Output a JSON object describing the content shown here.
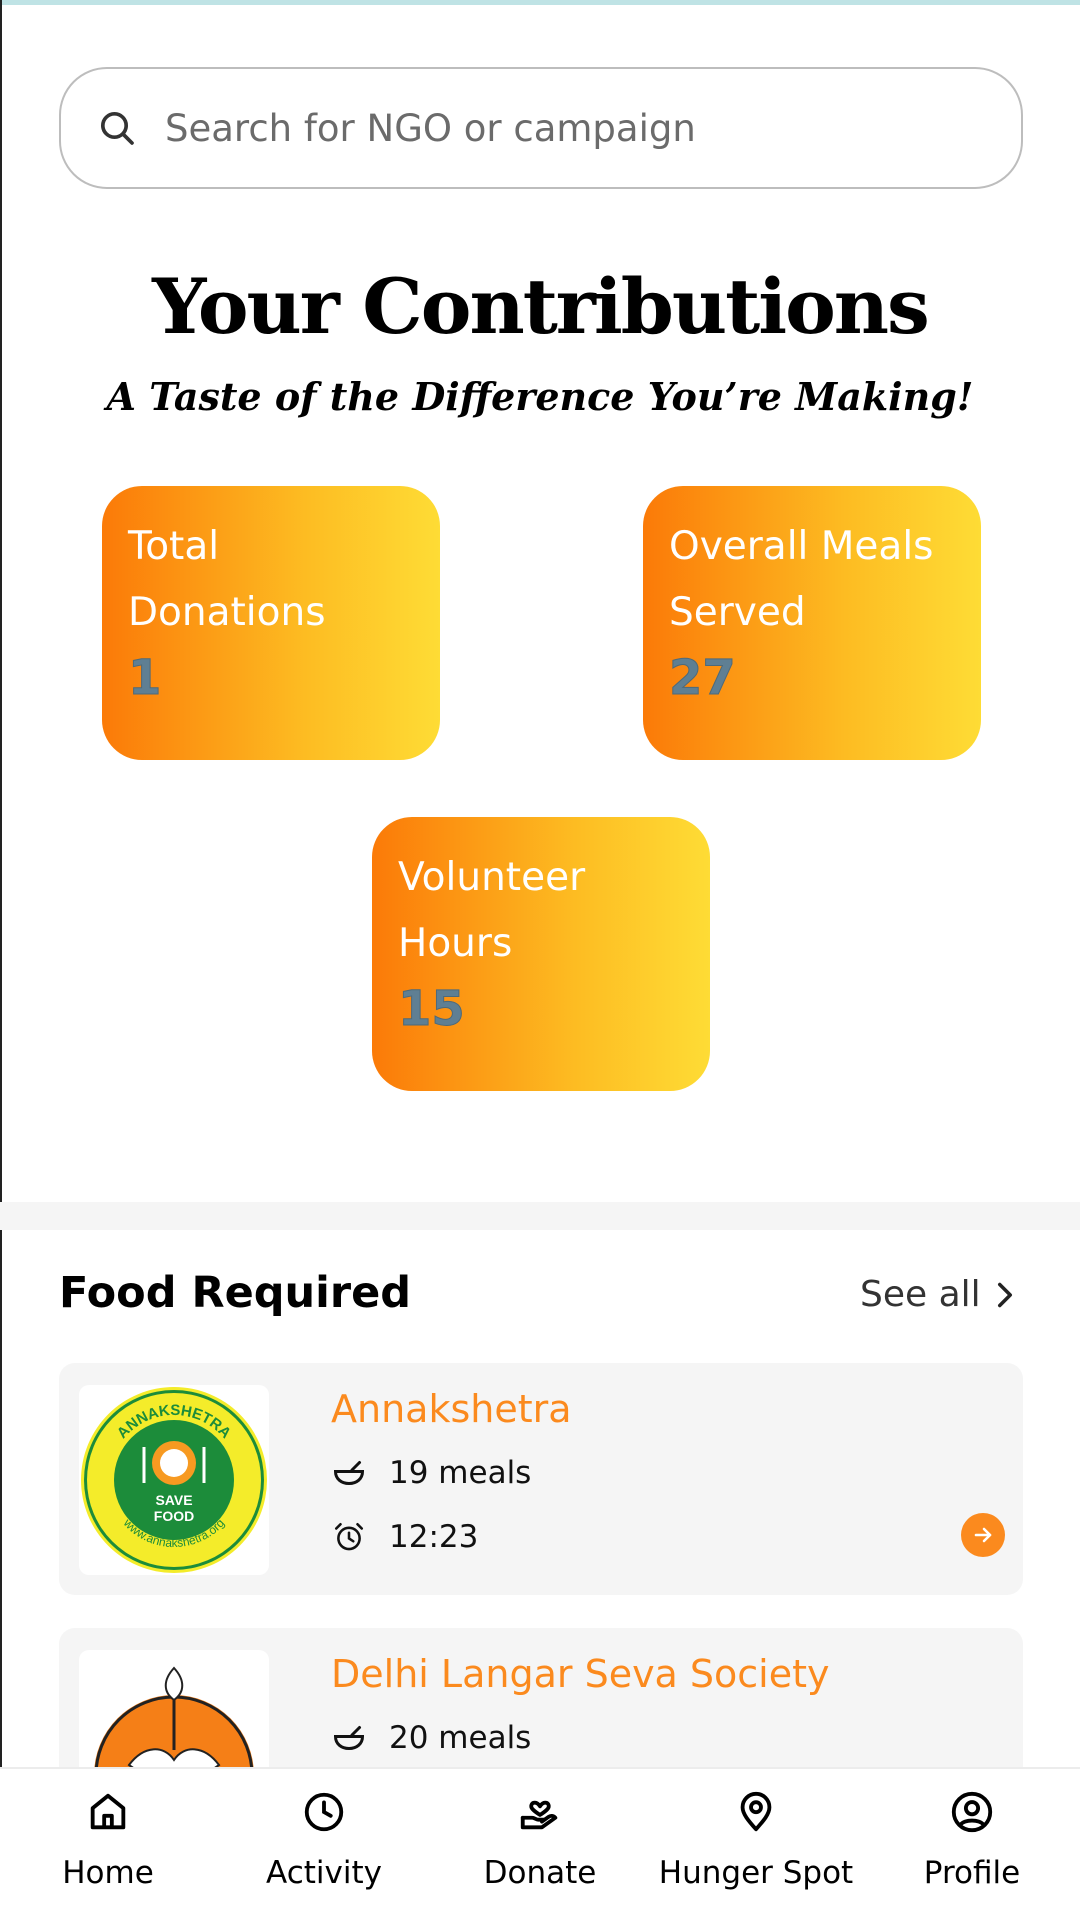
{
  "search": {
    "placeholder": "Search for NGO or campaign"
  },
  "contributions": {
    "title": "Your Contributions",
    "subtitle": "A Taste of the Difference You’re Making!",
    "stats": [
      {
        "label_line1": "Total",
        "label_line2": "Donations",
        "value": "1"
      },
      {
        "label_line1": "Overall Meals",
        "label_line2": "Served",
        "value": "27"
      },
      {
        "label_line1": "Volunteer",
        "label_line2": "Hours",
        "value": "15"
      }
    ]
  },
  "food_required": {
    "title": "Food Required",
    "see_all": "See all",
    "items": [
      {
        "name": "Annakshetra",
        "meals": "19 meals",
        "time": "12:23",
        "logo_text": {
          "ring_top": "ANNAKSHETRA",
          "ring_bottom": "www.annakshetra.org",
          "center_line1": "SAVE",
          "center_line2": "FOOD"
        }
      },
      {
        "name": "Delhi Langar Seva Society",
        "meals": "20 meals"
      }
    ]
  },
  "nav": [
    {
      "label": "Home",
      "icon": "home-icon"
    },
    {
      "label": "Activity",
      "icon": "clock-icon"
    },
    {
      "label": "Donate",
      "icon": "donate-hand-heart-icon"
    },
    {
      "label": "Hunger Spot",
      "icon": "location-pin-icon"
    },
    {
      "label": "Profile",
      "icon": "user-circle-icon"
    }
  ],
  "colors": {
    "accent": "#fb8a1e",
    "gradient_start": "#fb7a08",
    "gradient_end": "#fedc35",
    "stat_value": "#5f7f93"
  }
}
